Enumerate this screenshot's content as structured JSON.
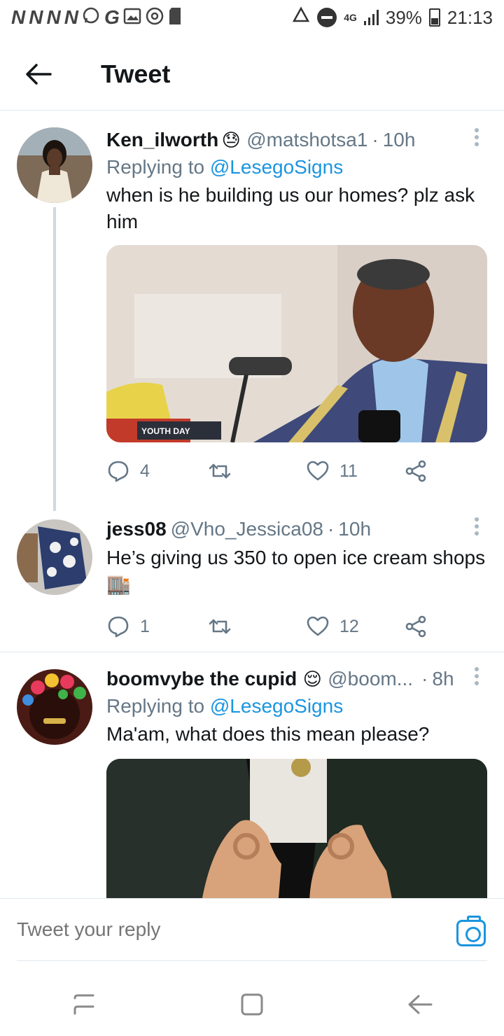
{
  "status_bar": {
    "left_glyphs": [
      "N",
      "N",
      "N",
      "N"
    ],
    "extra_glyphs": [
      "G"
    ],
    "network": "4G",
    "battery": "39%",
    "time": "21:13"
  },
  "header": {
    "title": "Tweet"
  },
  "tweets": [
    {
      "name": "Ken_ilworth",
      "name_emoji": "😓",
      "handle": "@matshotsa1",
      "time": "10h",
      "replying_label": "Replying to",
      "replying_to": "@LesegoSigns",
      "text": "when is he building us our homes? plz ask him",
      "media_caption": "YOUTH DAY",
      "replies": "4",
      "retweets": "",
      "likes": "11"
    },
    {
      "name": "jess08",
      "handle": "@Vho_Jessica08",
      "time": "10h",
      "text": "He’s giving us 350 to open ice cream shops 🏬",
      "replies": "1",
      "retweets": "",
      "likes": "12"
    },
    {
      "name": "boomvybe the cupid",
      "name_emoji": "😌",
      "handle": "@boom...",
      "time": "8h",
      "replying_label": "Replying to",
      "replying_to": "@LesegoSigns",
      "text": "Ma'am, what does this mean please?"
    }
  ],
  "reply_box": {
    "placeholder": "Tweet your reply"
  },
  "icons": {
    "back": "arrow-left-icon",
    "reply": "reply-icon",
    "retweet": "retweet-icon",
    "like": "heart-icon",
    "share": "share-icon",
    "more": "more-vertical-icon",
    "camera": "camera-icon"
  },
  "colors": {
    "link": "#1b95e0",
    "muted": "#657786",
    "text": "#14171a",
    "divider": "#e1e8ed"
  }
}
